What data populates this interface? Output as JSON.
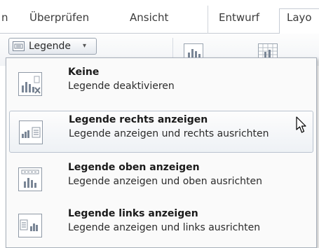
{
  "ribbon_tabs": [
    {
      "label": "n"
    },
    {
      "label": "Überprüfen"
    },
    {
      "label": "Ansicht"
    },
    {
      "label": "Entwurf"
    },
    {
      "label": "Layo"
    }
  ],
  "legend_button": {
    "label": "Legende",
    "caret": "▾",
    "icon": "legend-icon"
  },
  "menu": {
    "items": [
      {
        "title": "Keine",
        "description": "Legende deaktivieren",
        "icon": "legend-none-icon"
      },
      {
        "title": "Legende rechts anzeigen",
        "description": "Legende anzeigen und rechts ausrichten",
        "icon": "legend-right-icon",
        "hovered": true
      },
      {
        "title": "Legende oben anzeigen",
        "description": "Legende anzeigen und oben ausrichten",
        "icon": "legend-top-icon"
      },
      {
        "title": "Legende links anzeigen",
        "description": "Legende anzeigen und links ausrichten",
        "icon": "legend-left-icon"
      }
    ]
  },
  "colors": {
    "border": "#a8b0bb",
    "hover_bg": "#eef1f5",
    "bar": "#7a8696"
  }
}
